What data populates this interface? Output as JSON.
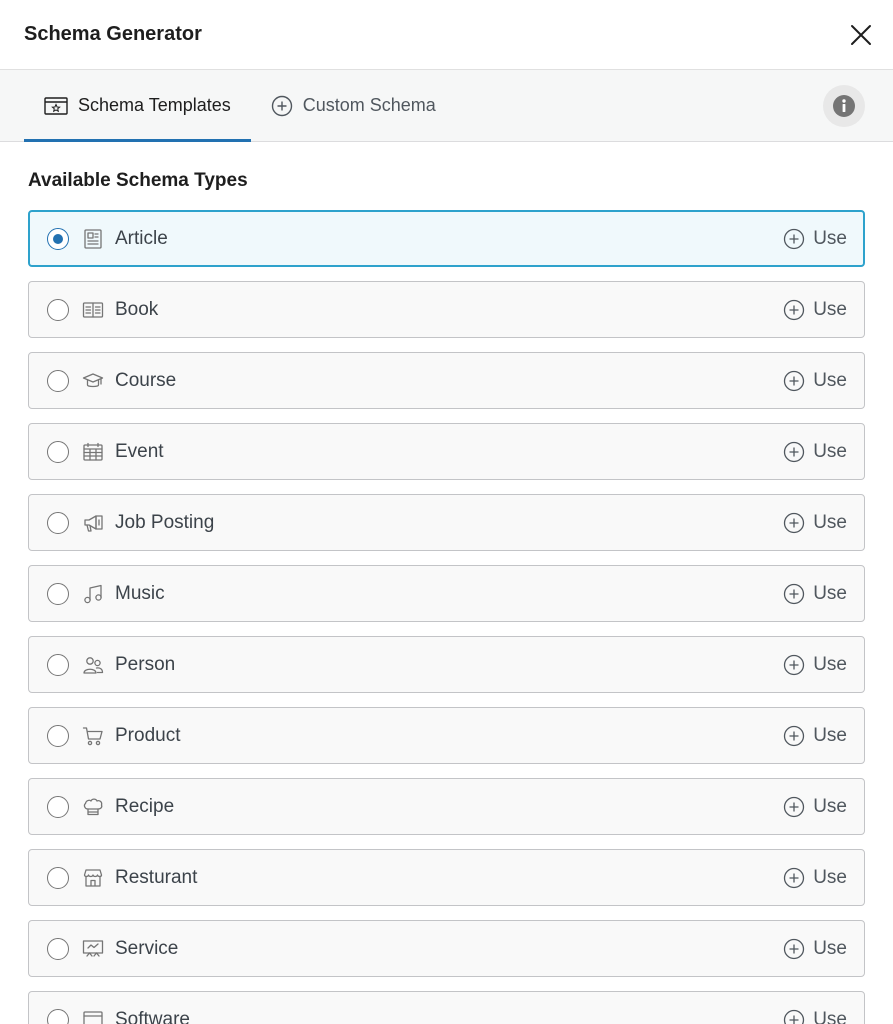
{
  "header": {
    "title": "Schema Generator"
  },
  "tabs": [
    {
      "label": "Schema Templates",
      "icon": "template-icon",
      "active": true
    },
    {
      "label": "Custom Schema",
      "icon": "plus-circle-icon",
      "active": false
    }
  ],
  "section_title": "Available Schema Types",
  "use_label": "Use",
  "items": [
    {
      "label": "Article",
      "icon": "article-icon",
      "selected": true
    },
    {
      "label": "Book",
      "icon": "book-icon",
      "selected": false
    },
    {
      "label": "Course",
      "icon": "graduation-cap-icon",
      "selected": false
    },
    {
      "label": "Event",
      "icon": "calendar-icon",
      "selected": false
    },
    {
      "label": "Job Posting",
      "icon": "megaphone-icon",
      "selected": false
    },
    {
      "label": "Music",
      "icon": "music-note-icon",
      "selected": false
    },
    {
      "label": "Person",
      "icon": "people-icon",
      "selected": false
    },
    {
      "label": "Product",
      "icon": "cart-icon",
      "selected": false
    },
    {
      "label": "Recipe",
      "icon": "chef-hat-icon",
      "selected": false
    },
    {
      "label": "Resturant",
      "icon": "store-icon",
      "selected": false
    },
    {
      "label": "Service",
      "icon": "presentation-icon",
      "selected": false
    },
    {
      "label": "Software",
      "icon": "window-icon",
      "selected": false
    }
  ],
  "colors": {
    "accent": "#2271b1",
    "selected_border": "#2ea2cc",
    "selected_bg": "#f0f9fc"
  }
}
